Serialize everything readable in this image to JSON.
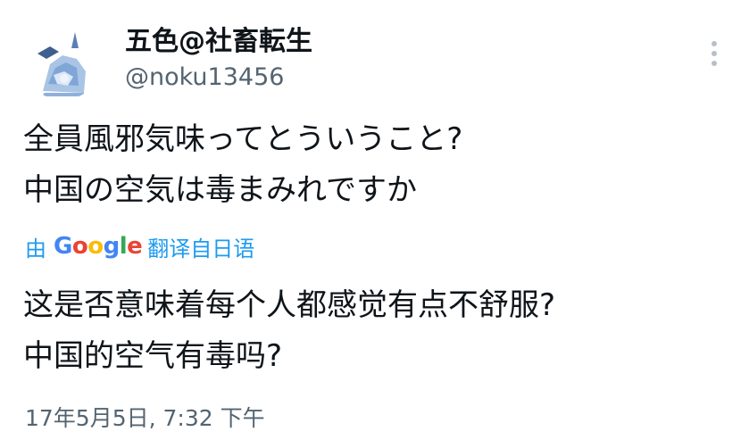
{
  "colors": {
    "text": "#0f1419",
    "secondary": "#536471",
    "link": "#1d9bf0",
    "more_dots": "#b8c0c7"
  },
  "author": {
    "display_name": "五色@社畜転生",
    "handle": "@noku13456",
    "avatar_icon": "avatar-image"
  },
  "more_icon": "more-vertical-icon",
  "tweet": {
    "original_lines": [
      "全員風邪気味ってとういうこと?",
      "中国の空気は毒まみれですか"
    ],
    "translation": {
      "prefix": "由",
      "provider_logo": [
        "G",
        "o",
        "o",
        "g",
        "l",
        "e"
      ],
      "suffix": "翻译自日语"
    },
    "translated_lines": [
      "这是否意味着每个人都感觉有点不舒服?",
      "中国的空气有毒吗?"
    ],
    "timestamp": "17年5月5日, 7:32 下午"
  }
}
